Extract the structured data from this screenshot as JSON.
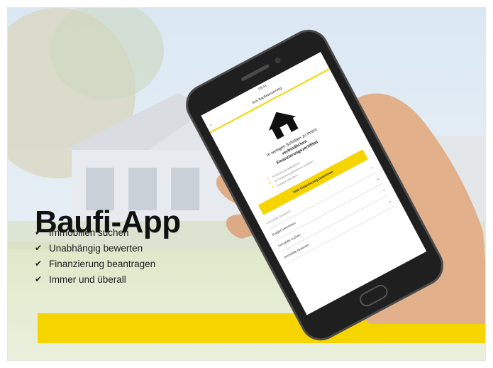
{
  "headline": "Baufi-App",
  "benefits": [
    "Immobilien suchen",
    "Unabhängig bewerten",
    "Finanzierung beantragen",
    "Immer und überall"
  ],
  "phone": {
    "status_time": "09:41",
    "nav_title": "Ihre Baufinanzierung",
    "nav_back": "‹",
    "intro_line1": "In wenigen Schritten zu Ihrem",
    "intro_line2": "verbindlichen",
    "intro_line3": "Finanzierungszertifikat",
    "features": [
      "Finanzierung kalkulieren",
      "Ihr Finanzierungsrahmen ermitteln",
      "Angebot anfordern"
    ],
    "cta_label": "Jetzt Finanzierung berechnen",
    "rows": [
      "Immobilie bewerten",
      "Budget berechnen",
      "Immobilie suchen",
      "Immobilie bewerten"
    ]
  },
  "colors": {
    "accent": "#f5d400",
    "text": "#111111"
  },
  "icons": [
    "check-icon",
    "house-icon",
    "chevron-down-icon"
  ]
}
